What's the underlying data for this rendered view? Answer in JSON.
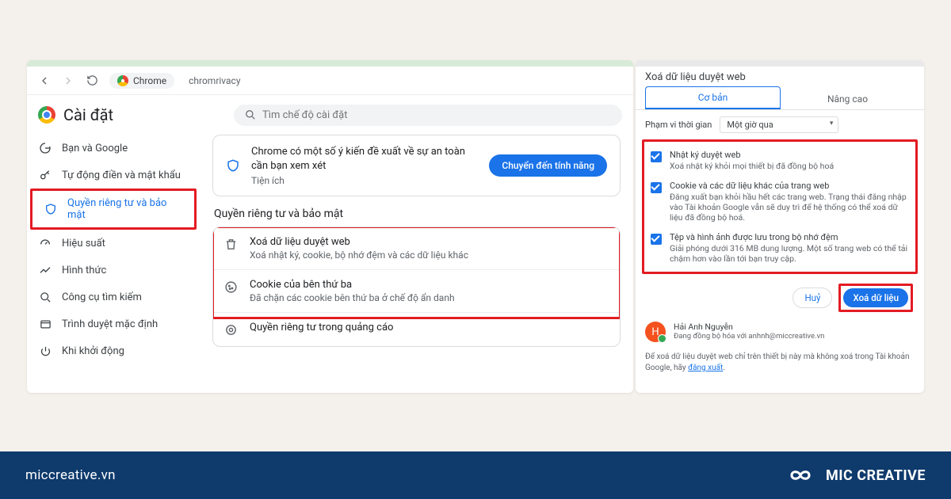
{
  "nav": {
    "chrome_chip": "Chrome",
    "address": "chromrivacy"
  },
  "header": {
    "settings_title": "Cài đặt",
    "search_placeholder": "Tìm chế độ cài đặt"
  },
  "sidebar": {
    "items": [
      {
        "label": "Bạn và Google"
      },
      {
        "label": "Tự động điền và mật khẩu"
      },
      {
        "label": "Quyền riêng tư và bảo mật"
      },
      {
        "label": "Hiệu suất"
      },
      {
        "label": "Hình thức"
      },
      {
        "label": "Công cụ tìm kiếm"
      },
      {
        "label": "Trình duyệt mặc định"
      },
      {
        "label": "Khi khởi động"
      }
    ]
  },
  "notice": {
    "title": "Chrome có một số ý kiến đề xuất về sự an toàn cần bạn xem xét",
    "sub": "Tiện ích",
    "button": "Chuyển đến tính năng"
  },
  "section_title": "Quyền riêng tư và bảo mật",
  "settings_rows": [
    {
      "title": "Xoá dữ liệu duyệt web",
      "sub": "Xoá nhật ký, cookie, bộ nhớ đệm và các dữ liệu khác"
    },
    {
      "title": "Cookie của bên thứ ba",
      "sub": "Đã chặn các cookie bên thứ ba ở chế độ ẩn danh"
    },
    {
      "title": "Quyền riêng tư trong quảng cáo",
      "sub": ""
    }
  ],
  "dialog": {
    "title": "Xoá dữ liệu duyệt web",
    "tabs": {
      "basic": "Cơ bản",
      "advanced": "Nâng cao"
    },
    "range_label": "Phạm vi thời gian",
    "range_value": "Một giờ qua",
    "rows": [
      {
        "title": "Nhật ký duyệt web",
        "sub": "Xoá nhật ký khỏi mọi thiết bị đã đồng bộ hoá"
      },
      {
        "title": "Cookie và các dữ liệu khác của trang web",
        "sub": "Đăng xuất bạn khỏi hầu hết các trang web. Trạng thái đăng nhập vào Tài khoản Google vẫn sẽ duy trì để hệ thống có thể xoá dữ liệu đã đồng bộ hoá."
      },
      {
        "title": "Tệp và hình ảnh được lưu trong bộ nhớ đệm",
        "sub": "Giải phóng dưới 316 MB dung lượng. Một số trang web có thể tải chậm hơn vào lần tới bạn truy cập."
      }
    ],
    "cancel": "Huỷ",
    "confirm": "Xoá dữ liệu",
    "user_name": "Hải Anh Nguyễn",
    "user_sub": "Đang đồng bộ hóa với anhnh@miccreative.vn",
    "avatar_initial": "H",
    "note_pre": "Để xoá dữ liệu duyệt web chỉ trên thiết bị này mà không xoá trong Tài khoản Google, hãy ",
    "note_link": "đăng xuất",
    "note_post": "."
  },
  "brand": {
    "domain": "miccreative.vn",
    "name": "MIC CREATIVE"
  }
}
